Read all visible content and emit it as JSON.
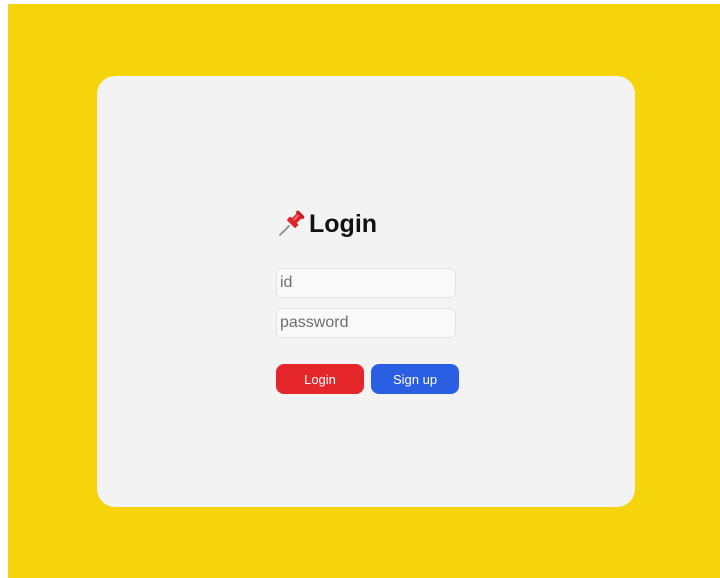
{
  "colors": {
    "background": "#f5d40c",
    "card": "#f3f3f3",
    "login_button": "#e5262a",
    "signup_button": "#2b5fe3"
  },
  "login": {
    "icon": "pushpin-icon",
    "title": "Login",
    "id_placeholder": "id",
    "password_placeholder": "password",
    "login_button": "Login",
    "signup_button": "Sign up"
  }
}
